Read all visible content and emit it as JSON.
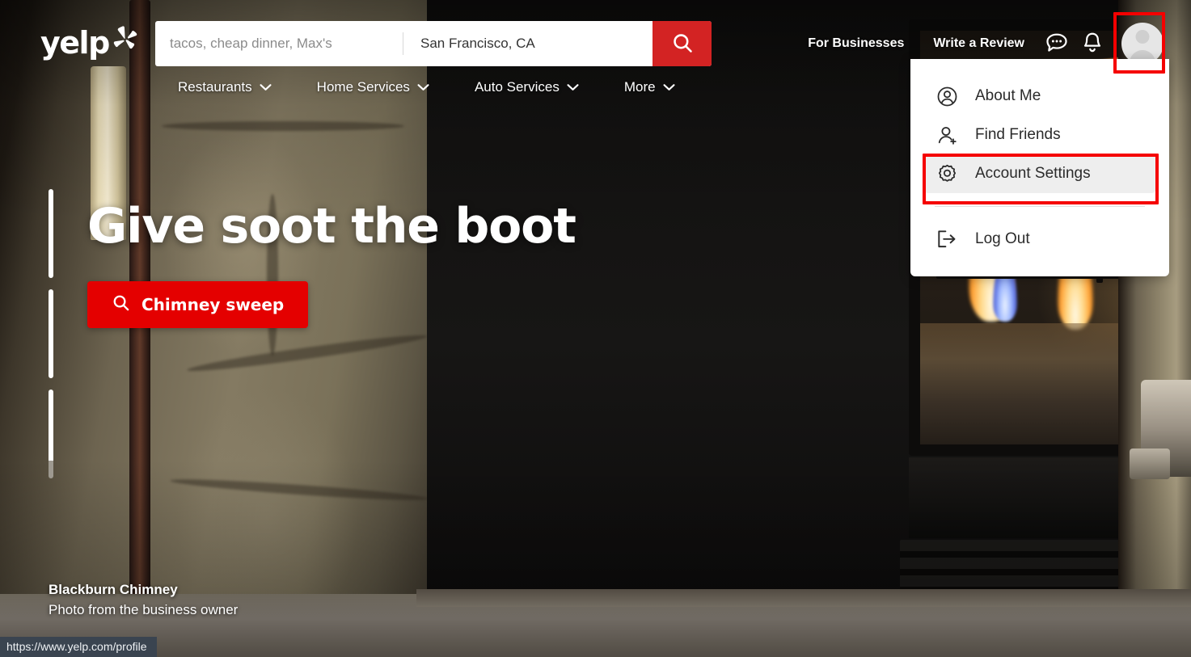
{
  "brand": {
    "name": "yelp",
    "accent": "#d32323",
    "cta_color": "#e40000",
    "annotation_color": "#f50000"
  },
  "search": {
    "term_value": "",
    "term_placeholder": "tacos, cheap dinner, Max's",
    "location_value": "San Francisco, CA",
    "location_placeholder": "San Francisco, CA",
    "button_icon": "search-icon"
  },
  "header": {
    "links": [
      {
        "label": "For Businesses",
        "name": "for-businesses-link"
      },
      {
        "label": "Write a Review",
        "name": "write-a-review-link"
      }
    ],
    "icons": [
      {
        "name": "messages-icon",
        "label": "Messages"
      },
      {
        "name": "notifications-bell-icon",
        "label": "Notifications"
      }
    ],
    "avatar_label": "User profile"
  },
  "category_nav": [
    {
      "label": "Restaurants",
      "name": "nav-restaurants"
    },
    {
      "label": "Home Services",
      "name": "nav-home-services"
    },
    {
      "label": "Auto Services",
      "name": "nav-auto-services"
    },
    {
      "label": "More",
      "name": "nav-more"
    }
  ],
  "hero": {
    "title": "Give soot the boot",
    "cta_label": "Chimney sweep",
    "cta_icon": "search-icon",
    "credit_business": "Blackburn Chimney",
    "credit_source": "Photo from the business owner",
    "carousel_slides": 3,
    "carousel_active_index": 2
  },
  "profile_menu": {
    "items": [
      {
        "label": "About Me",
        "icon": "user-circle-icon",
        "name": "menu-item-about-me",
        "active": false
      },
      {
        "label": "Find Friends",
        "icon": "user-plus-icon",
        "name": "menu-item-find-friends",
        "active": false
      },
      {
        "label": "Account Settings",
        "icon": "gear-icon",
        "name": "menu-item-account-settings",
        "active": true
      },
      {
        "label": "Log Out",
        "icon": "logout-arrow-icon",
        "name": "menu-item-log-out",
        "active": false
      }
    ]
  },
  "status_bar": {
    "url": "https://www.yelp.com/profile"
  },
  "annotations": [
    {
      "name": "annotation-avatar-box",
      "target": "avatar-button"
    },
    {
      "name": "annotation-account-settings-box",
      "target": "menu-item-account-settings"
    }
  ]
}
